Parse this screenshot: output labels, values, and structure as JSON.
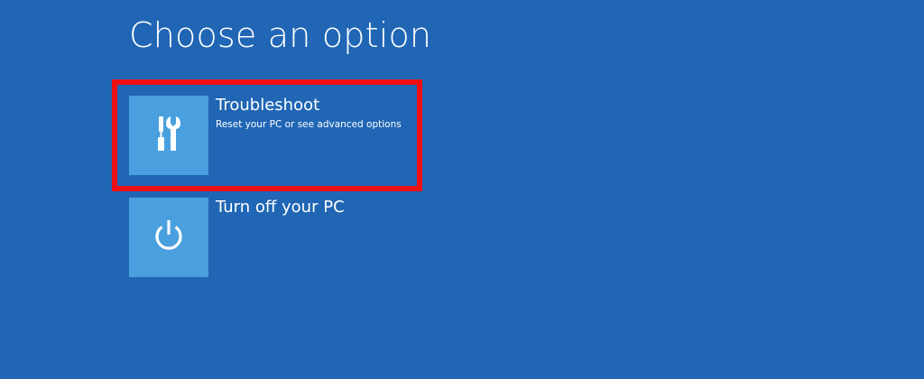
{
  "page": {
    "title": "Choose an option",
    "background_color": "#2066b5",
    "tile_color": "#4aa0de",
    "highlight_color": "#ee0f12"
  },
  "options": [
    {
      "label": "Troubleshoot",
      "description": "Reset your PC or see advanced options",
      "icon": "tools-icon",
      "highlighted": true
    },
    {
      "label": "Turn off your PC",
      "description": "",
      "icon": "power-icon",
      "highlighted": false
    }
  ]
}
